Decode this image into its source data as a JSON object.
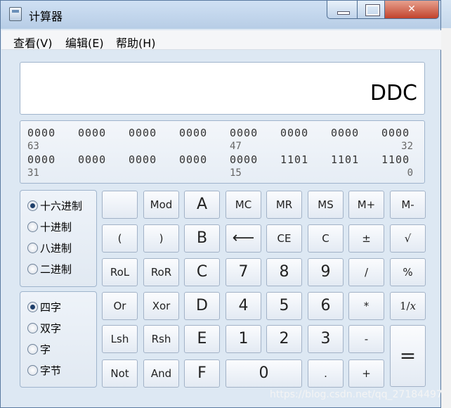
{
  "window": {
    "title": "计算器"
  },
  "menu": [
    "查看(V)",
    "编辑(E)",
    "帮助(H)"
  ],
  "display": {
    "value": "DDC"
  },
  "bits": {
    "row1": [
      "0000",
      "0000",
      "0000",
      "0000",
      "0000",
      "0000",
      "0000",
      "0000"
    ],
    "row1_labels": {
      "left": "63",
      "mid": "47",
      "right": "32"
    },
    "row2": [
      "0000",
      "0000",
      "0000",
      "0000",
      "0000",
      "1101",
      "1101",
      "1100"
    ],
    "row2_labels": {
      "left": "31",
      "mid": "15",
      "right": "0"
    }
  },
  "base": {
    "selected": "十六进制",
    "options": [
      "十六进制",
      "十进制",
      "八进制",
      "二进制"
    ]
  },
  "word": {
    "selected": "四字",
    "options": [
      "四字",
      "双字",
      "字",
      "字节"
    ]
  },
  "buttons": {
    "blank": "",
    "mod": "Mod",
    "a": "A",
    "mc": "MC",
    "mr": "MR",
    "ms": "MS",
    "mplus": "M+",
    "mminus": "M-",
    "lparen": "(",
    "rparen": ")",
    "b": "B",
    "back": "⟵",
    "ce": "CE",
    "c": "C",
    "plusminus": "±",
    "sqrt": "√",
    "rol": "RoL",
    "ror": "RoR",
    "cc": "C",
    "seven": "7",
    "eight": "8",
    "nine": "9",
    "div": "/",
    "pct": "%",
    "or": "Or",
    "xor": "Xor",
    "d": "D",
    "four": "4",
    "five": "5",
    "six": "6",
    "mul": "*",
    "recip": "1/𝑥",
    "lsh": "Lsh",
    "rsh": "Rsh",
    "e": "E",
    "one": "1",
    "two": "2",
    "three": "3",
    "minus": "-",
    "equals": "=",
    "not": "Not",
    "and": "And",
    "f": "F",
    "zero": "0",
    "dot": ".",
    "plus": "+"
  },
  "watermark": "https://blog.csdn.net/qq_27184497"
}
